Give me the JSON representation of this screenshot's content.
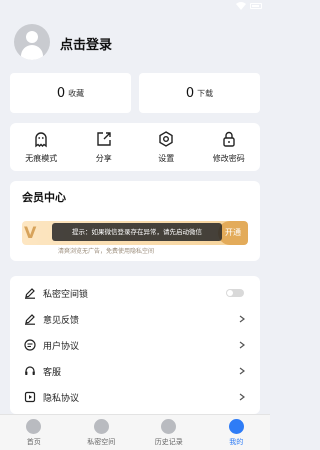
{
  "header": {
    "login_text": "点击登录"
  },
  "stats": [
    {
      "value": "0",
      "label": "收藏"
    },
    {
      "value": "0",
      "label": "下载"
    }
  ],
  "actions": [
    {
      "label": "无痕模式",
      "icon": "ghost-icon"
    },
    {
      "label": "分享",
      "icon": "share-icon"
    },
    {
      "label": "设置",
      "icon": "hexagon-gear-icon"
    },
    {
      "label": "修改密码",
      "icon": "lock-icon"
    }
  ],
  "member": {
    "title": "会员中心",
    "badge": "V",
    "button": "开通",
    "desc": "清爽浏览无广告，免费使用隐私空间"
  },
  "toast": {
    "text": "提示：如果微信登录存在异常，请先启动微信"
  },
  "settings": [
    {
      "label": "私密空间锁",
      "icon": "pencil-icon",
      "control": "toggle",
      "toggle_on": false
    },
    {
      "label": "意见反馈",
      "icon": "pencil-icon",
      "control": "chevron"
    },
    {
      "label": "用户协议",
      "icon": "user-agreement-icon",
      "control": "chevron"
    },
    {
      "label": "客服",
      "icon": "headset-icon",
      "control": "chevron"
    },
    {
      "label": "隐私协议",
      "icon": "play-doc-icon",
      "control": "chevron"
    }
  ],
  "tabs": [
    {
      "label": "首页",
      "active": false
    },
    {
      "label": "私密空间",
      "active": false
    },
    {
      "label": "历史记录",
      "active": false
    },
    {
      "label": "我的",
      "active": true
    }
  ],
  "colors": {
    "accent": "#2e7cf6",
    "background": "#eef0f5",
    "gold": "#e3ab5a"
  }
}
